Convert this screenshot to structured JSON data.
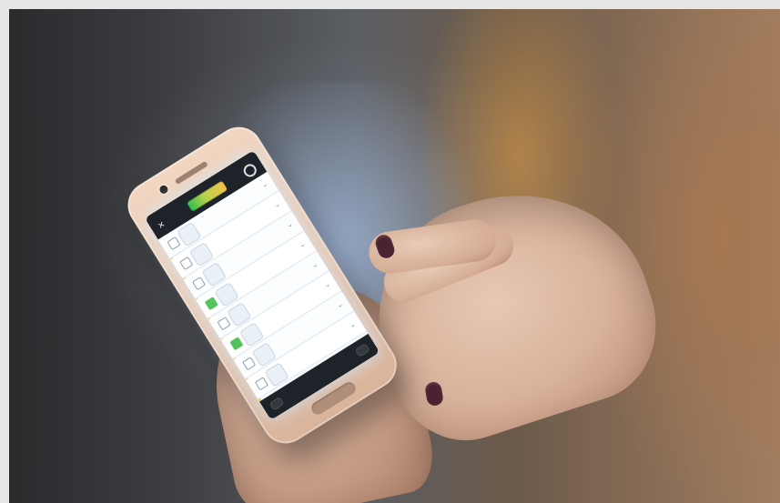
{
  "scene": {
    "subject": "Person holding a smartphone displaying a checklist app"
  },
  "phone_ui": {
    "status": {
      "left": "",
      "right": ""
    },
    "logo_text": "",
    "items": [
      {
        "label": "",
        "qty": "",
        "checked": false
      },
      {
        "label": "",
        "qty": "",
        "checked": false
      },
      {
        "label": "",
        "qty": "",
        "checked": false
      },
      {
        "label": "",
        "qty": "",
        "checked": true
      },
      {
        "label": "",
        "qty": "",
        "checked": false
      },
      {
        "label": "",
        "qty": "",
        "checked": true
      },
      {
        "label": "",
        "qty": "",
        "checked": false
      },
      {
        "label": "",
        "qty": "",
        "checked": false
      }
    ],
    "bottom_buttons": {
      "left": "",
      "right": ""
    }
  },
  "colors": {
    "accent_green": "#53c45b",
    "accent_yellow": "#f2c14a",
    "ui_dark": "#1d2328",
    "screen_white": "#f7fbff"
  }
}
